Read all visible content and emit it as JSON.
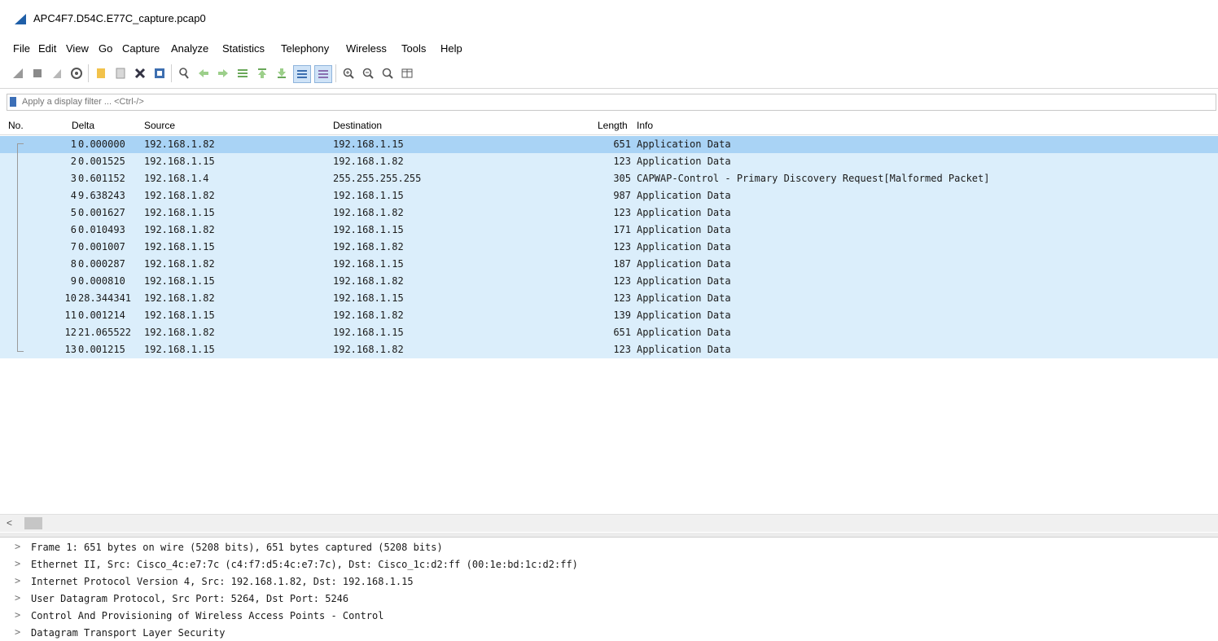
{
  "window": {
    "title": "APC4F7.D54C.E77C_capture.pcap0"
  },
  "menu": [
    "File",
    "Edit",
    "View",
    "Go",
    "Capture",
    "Analyze",
    "Statistics",
    "Telephony",
    "Wireless",
    "Tools",
    "Help"
  ],
  "toolbar": {
    "icons": [
      "shark-fin-start-icon",
      "stop-icon",
      "restart-icon",
      "capture-options-icon",
      "open-file-icon",
      "save-file-icon",
      "close-file-icon",
      "reload-icon",
      "find-icon",
      "go-back-icon",
      "go-forward-icon",
      "go-to-packet-icon",
      "first-packet-icon",
      "last-packet-icon",
      "autoscroll-icon",
      "colorize-icon",
      "zoom-in-icon",
      "zoom-out-icon",
      "zoom-normal-icon",
      "resize-columns-icon"
    ]
  },
  "filter": {
    "placeholder": "Apply a display filter ... <Ctrl-/>"
  },
  "columns": {
    "no": "No.",
    "delta": "Delta",
    "source": "Source",
    "destination": "Destination",
    "length": "Length",
    "info": "Info"
  },
  "packets": [
    {
      "no": "1",
      "delta": "0.000000",
      "source": "192.168.1.82",
      "destination": "192.168.1.15",
      "length": "651",
      "info": "Application Data"
    },
    {
      "no": "2",
      "delta": "0.001525",
      "source": "192.168.1.15",
      "destination": "192.168.1.82",
      "length": "123",
      "info": "Application Data"
    },
    {
      "no": "3",
      "delta": "0.601152",
      "source": "192.168.1.4",
      "destination": "255.255.255.255",
      "length": "305",
      "info": "CAPWAP-Control - Primary Discovery Request[Malformed Packet]"
    },
    {
      "no": "4",
      "delta": "9.638243",
      "source": "192.168.1.82",
      "destination": "192.168.1.15",
      "length": "987",
      "info": "Application Data"
    },
    {
      "no": "5",
      "delta": "0.001627",
      "source": "192.168.1.15",
      "destination": "192.168.1.82",
      "length": "123",
      "info": "Application Data"
    },
    {
      "no": "6",
      "delta": "0.010493",
      "source": "192.168.1.82",
      "destination": "192.168.1.15",
      "length": "171",
      "info": "Application Data"
    },
    {
      "no": "7",
      "delta": "0.001007",
      "source": "192.168.1.15",
      "destination": "192.168.1.82",
      "length": "123",
      "info": "Application Data"
    },
    {
      "no": "8",
      "delta": "0.000287",
      "source": "192.168.1.82",
      "destination": "192.168.1.15",
      "length": "187",
      "info": "Application Data"
    },
    {
      "no": "9",
      "delta": "0.000810",
      "source": "192.168.1.15",
      "destination": "192.168.1.82",
      "length": "123",
      "info": "Application Data"
    },
    {
      "no": "10",
      "delta": "28.344341",
      "source": "192.168.1.82",
      "destination": "192.168.1.15",
      "length": "123",
      "info": "Application Data"
    },
    {
      "no": "11",
      "delta": "0.001214",
      "source": "192.168.1.15",
      "destination": "192.168.1.82",
      "length": "139",
      "info": "Application Data"
    },
    {
      "no": "12",
      "delta": "21.065522",
      "source": "192.168.1.82",
      "destination": "192.168.1.15",
      "length": "651",
      "info": "Application Data"
    },
    {
      "no": "13",
      "delta": "0.001215",
      "source": "192.168.1.15",
      "destination": "192.168.1.82",
      "length": "123",
      "info": "Application Data"
    }
  ],
  "scroll": {
    "left_arrow": "<"
  },
  "details": [
    "Frame 1: 651 bytes on wire (5208 bits), 651 bytes captured (5208 bits)",
    "Ethernet II, Src: Cisco_4c:e7:7c (c4:f7:d5:4c:e7:7c), Dst: Cisco_1c:d2:ff (00:1e:bd:1c:d2:ff)",
    "Internet Protocol Version 4, Src: 192.168.1.82, Dst: 192.168.1.15",
    "User Datagram Protocol, Src Port: 5264, Dst Port: 5246",
    "Control And Provisioning of Wireless Access Points - Control",
    "Datagram Transport Layer Security"
  ],
  "colors": {
    "row_bg": "#dbeefb",
    "row_selected": "#a9d3f5",
    "accent": "#1f5fa8"
  }
}
